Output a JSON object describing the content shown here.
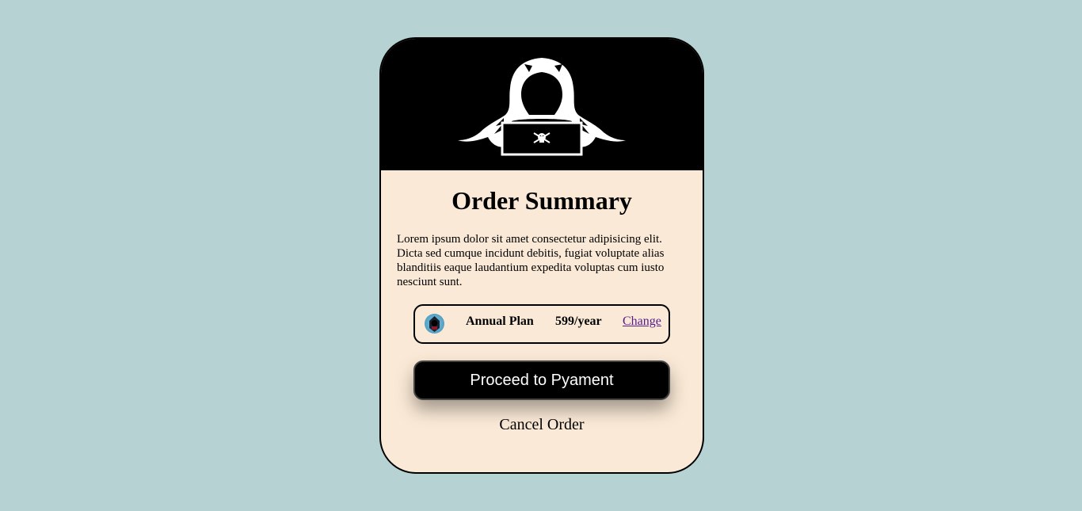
{
  "card": {
    "hero_image": "hooded-hacker-laptop-illustration",
    "title": "Order Summary",
    "description": "Lorem ipsum dolor sit amet consectetur adipisicing elit. Dicta sed cumque incidunt debitis, fugiat voluptate alias blanditiis eaque laudantium expedita voluptas cum iusto nesciunt sunt."
  },
  "plan": {
    "icon": "hacker-avatar-icon",
    "name": "Annual Plan",
    "price": "599/year",
    "change_label": "Change"
  },
  "actions": {
    "pay_label": "Proceed to Pyament",
    "cancel_label": "Cancel Order"
  },
  "colors": {
    "background": "#b7d2d3",
    "card": "#fae9d6",
    "hero": "#000000",
    "link": "#551a8b"
  }
}
